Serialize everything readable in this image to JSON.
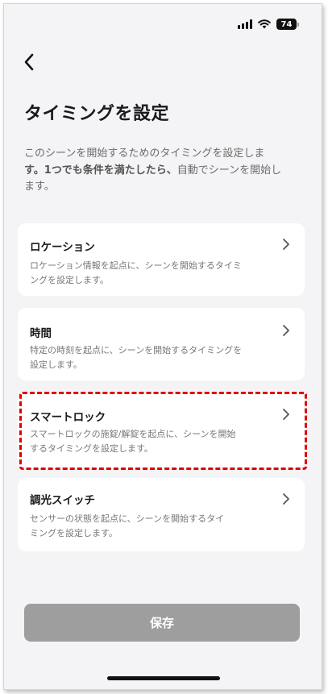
{
  "status_bar": {
    "battery": "74"
  },
  "header": {
    "back_icon": "chevron-left-icon",
    "title": "タイミングを設定"
  },
  "description": {
    "part1": "このシーンを開始するためのタイミングを設定しま",
    "part2": "す。1つでも条件を満たしたら、",
    "part3": "自動でシーンを開始し",
    "part4": "ます。"
  },
  "options": [
    {
      "title": "ロケーション",
      "line1": "ロケーション情報を起点に、シーンを開始するタイミ",
      "line2": "ングを設定します。"
    },
    {
      "title": "時間",
      "line1": "特定の時刻を起点に、シーンを開始するタイミングを",
      "line2": "設定します。"
    },
    {
      "title": "スマートロック",
      "line1": "スマートロックの施錠/解錠を起点に、シーンを開始",
      "line2": "するタイミングを設定します。"
    },
    {
      "title": "調光スイッチ",
      "line1": "センサーの状態を起点に、シーンを開始するタイ",
      "line2": "ミングを設定します。"
    }
  ],
  "footer": {
    "save_label": "保存"
  },
  "colors": {
    "highlight": "#e00000",
    "save_button": "#9e9e9e",
    "background": "#f4f4f6"
  }
}
